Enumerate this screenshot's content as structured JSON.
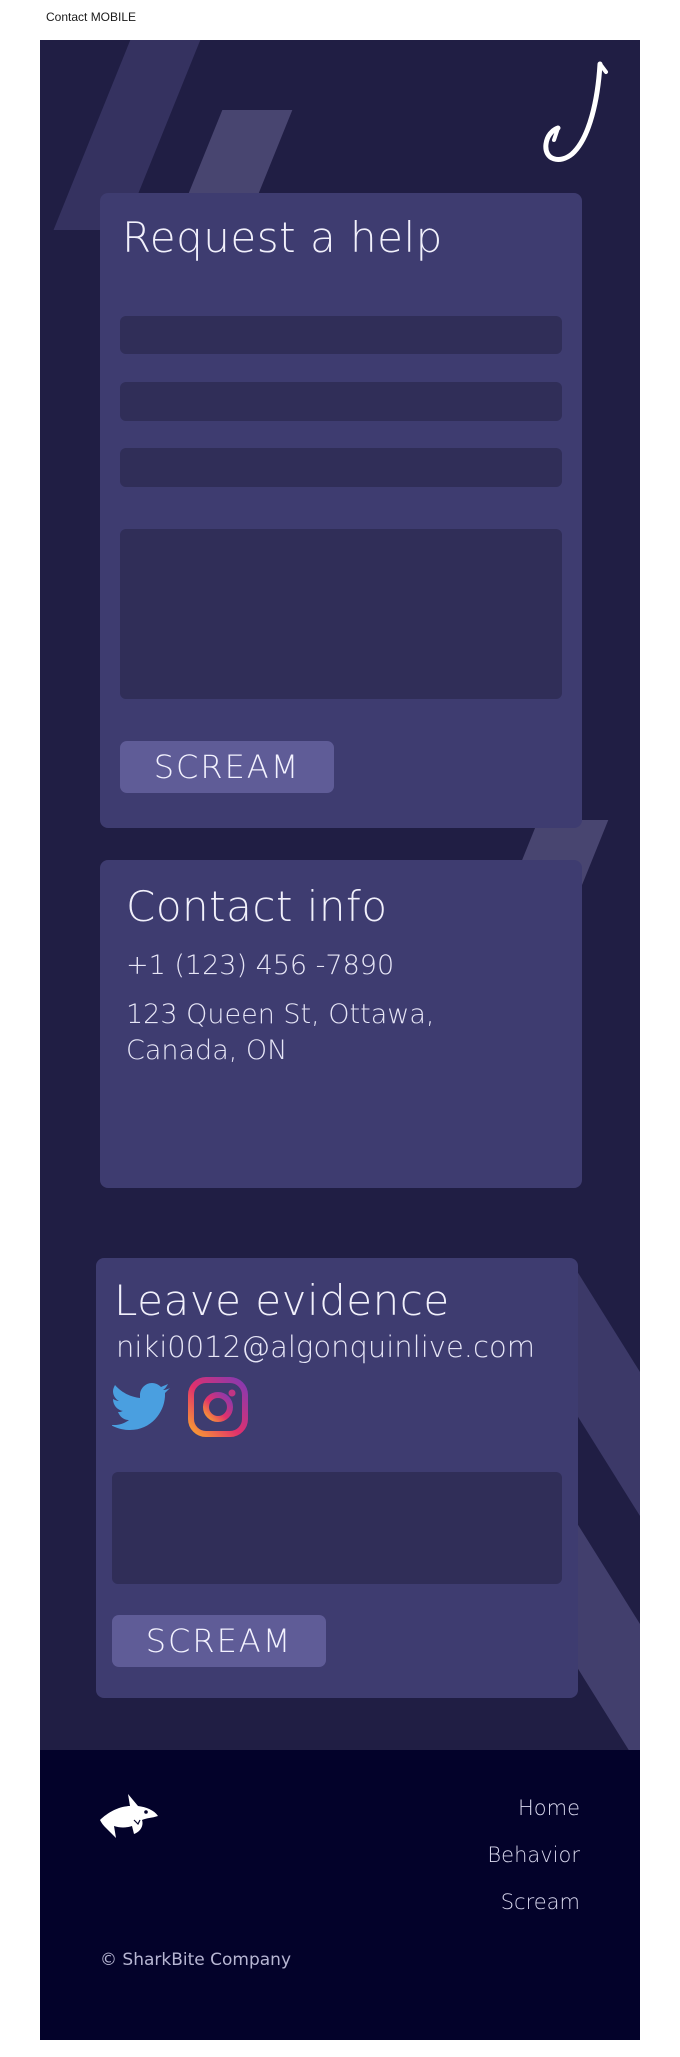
{
  "frame_label": "Contact MOBILE",
  "help_form": {
    "title": "Request a help",
    "submit_label": "SCREAM"
  },
  "contact_info": {
    "title": "Contact info",
    "phone": "+1 (123) 456 -7890",
    "address_line1": "123 Queen St, Ottawa,",
    "address_line2": "Canada, ON"
  },
  "evidence": {
    "title": "Leave evidence",
    "email": "niki0012@algonquinlive.com",
    "social_icons": [
      "twitter-icon",
      "instagram-icon"
    ],
    "submit_label": "SCREAM"
  },
  "footer": {
    "logo_icon": "shark-logo-icon",
    "nav": [
      {
        "label": "Home"
      },
      {
        "label": "Behavior"
      },
      {
        "label": "Scream"
      }
    ],
    "copyright": "© SharkBite Company"
  },
  "colors": {
    "page_bg": "#201e44",
    "card_bg": "#3e3c70",
    "field_bg": "#302e58",
    "button_bg": "#5f5c97",
    "footer_bg": "#03022a",
    "twitter_blue": "#4a9fe0"
  }
}
